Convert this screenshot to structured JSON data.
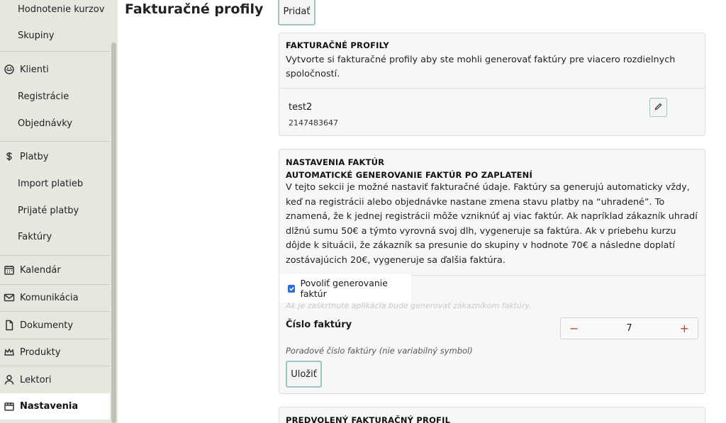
{
  "sidebar": {
    "items": [
      {
        "label": "Hodnotenie kurzov",
        "icon": "",
        "type": "sub"
      },
      {
        "label": "Skupiny",
        "icon": "",
        "type": "sub"
      },
      {
        "label": "Klienti",
        "icon": "clients-icon",
        "type": "main"
      },
      {
        "label": "Registrácie",
        "icon": "",
        "type": "sub"
      },
      {
        "label": "Objednávky",
        "icon": "",
        "type": "sub"
      },
      {
        "label": "Platby",
        "icon": "payments-icon",
        "type": "main"
      },
      {
        "label": "Import platieb",
        "icon": "",
        "type": "sub"
      },
      {
        "label": "Prijaté platby",
        "icon": "",
        "type": "sub"
      },
      {
        "label": "Faktúry",
        "icon": "",
        "type": "sub"
      },
      {
        "label": "Kalendár",
        "icon": "calendar-icon",
        "type": "main"
      },
      {
        "label": "Komunikácia",
        "icon": "mail-icon",
        "type": "main"
      },
      {
        "label": "Dokumenty",
        "icon": "document-icon",
        "type": "main"
      },
      {
        "label": "Produkty",
        "icon": "crown-icon",
        "type": "main"
      },
      {
        "label": "Lektori",
        "icon": "user-icon",
        "type": "main"
      },
      {
        "label": "Nastavenia",
        "icon": "settings-icon",
        "type": "main",
        "active": true
      }
    ]
  },
  "main": {
    "title": "Fakturačné profily",
    "add_button": "Pridať",
    "profiles_card": {
      "title": "FAKTURAČNÉ PROFILY",
      "description": "Vytvorte si fakturačné profily aby ste mohli generovať faktúry pre viacero rozdielnych spoločností.",
      "profile": {
        "name": "test2",
        "number": "2147483647"
      }
    },
    "settings_card": {
      "title": "NASTAVENIA FAKTÚR",
      "subtitle": "AUTOMATICKÉ GENEROVANIE FAKTÚR PO ZAPLATENÍ",
      "description": "V tejto sekcii je možné nastaviť fakturačné údaje. Faktúry sa generujú automaticky vždy, keď na registrácii alebo objednávke nastane zmena stavu platby na “uhradené”. To znamená, že k jednej registrácii môže vzniknúť aj viac faktúr. Ak napríklad zákazník uhradí dlžnú sumu 50€ a týmto vyrovná svoj dlh, vygeneruje sa faktúra. Ak v priebehu kurzu dôjde k situácii, že zákazník sa presunie do skupiny v hodnote 70€ a následne doplatí zostávajúcich 20€, vygeneruje sa ďalšia faktúra.",
      "checkbox_label": "Povoliť generovanie faktúr",
      "checkbox_checked": true,
      "checkbox_help": "Ak je zaškrtnuté aplikácia bude generovať zákazníkom faktúry.",
      "invoice_number_label": "Číslo faktúry",
      "invoice_number_value": "7",
      "minus": "−",
      "plus": "+",
      "invoice_number_help": "Poradové číslo faktúry (nie variabilný symbol)",
      "save_button": "Uložiť"
    },
    "default_card": {
      "title": "PREDVOLENÝ FAKTURAČNÝ PROFIL"
    }
  },
  "colors": {
    "sidebar_bg": "#e6e8df",
    "accent_border": "#9cc5c4",
    "checkbox_blue": "#2b6fd6",
    "stepper_red": "#dd3333"
  }
}
